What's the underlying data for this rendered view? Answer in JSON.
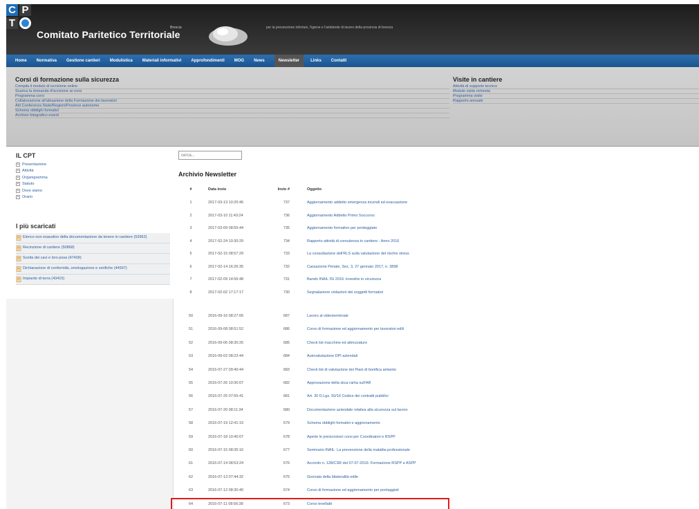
{
  "header": {
    "logo_letters": [
      "C",
      "P",
      "T"
    ],
    "brand": "Comitato Paritetico Territoriale",
    "brand_sub": "Brescia",
    "tagline": "per la prevenzione infortuni, l'igiene e l'ambiente di lavoro della provincia di brescia"
  },
  "nav": [
    "Home",
    "Normativa",
    "Gestione cantieri",
    "Modulistica",
    "Materiali informativi",
    "Approfondimenti",
    "MOG",
    "News",
    "Newsletter",
    "Links",
    "Contatti"
  ],
  "nav_active": "Newsletter",
  "training": {
    "title": "Corsi di formazione sulla sicurezza",
    "links": [
      "Compila il modulo di iscrizione online",
      "Scarica la domanda d'iscrizione ai corsi",
      "Programma corsi",
      "Collaborazione all'attuazione della Formazione dei lavoratori",
      "Atti Conferenza Stato/Regioni/Province autonome",
      "Schema obblighi formativi",
      "Archivio fotografico eventi"
    ]
  },
  "visits": {
    "title": "Visite in cantiere",
    "links": [
      "Attività di supporto tecnico",
      "Modulo visita richiesta",
      "Programma visite",
      "Rapporto annuale"
    ]
  },
  "cpt": {
    "title": "IL CPT",
    "items": [
      "Presentazione",
      "Attività",
      "Organigramma",
      "Statuto",
      "Dove siamo",
      "Orario"
    ]
  },
  "downloads": {
    "title": "I più scaricati",
    "items": [
      "Elenco non esaustivo della documentazione da tenere in cantiere (53962)",
      "Recinzione di cantiere (50868)",
      "Scelta dei cavi e loro posa (47409)",
      "Dichiarazione di conformità, omologazione e verifiche (44597)",
      "Impianto di terra (43415)"
    ]
  },
  "search": {
    "placeholder": "cerca..."
  },
  "archive": {
    "title": "Archivio Newsletter",
    "headers": [
      "#",
      "Data invio",
      "Invio #",
      "Oggetto"
    ],
    "rows_top": [
      [
        "1",
        "2017-03-13 10:20:46",
        "737",
        "Aggiornamento addetto emergenza incendi ed evacuazione"
      ],
      [
        "2",
        "2017-03-10 11:43:24",
        "736",
        "Aggiornamento Addetto Primo Soccorso"
      ],
      [
        "3",
        "2017-03-09 08:55:44",
        "735",
        "Aggiornamento formativo per ponteggiato"
      ],
      [
        "4",
        "2017-02-24 10:30:29",
        "734",
        "Rapporto attività di consulenza in cantiere - Anno 2016"
      ],
      [
        "5",
        "2017-02-15 08:57:29",
        "733",
        "La consultazione dell'RLS sulla valutazione del rischio stress"
      ],
      [
        "6",
        "2017-02-14 16:26:35",
        "732",
        "Cassazione Penale, Sez. 3, 27 gennaio 2017, n. 3898"
      ],
      [
        "7",
        "2017-02-09 14:56:48",
        "731",
        "Bando INAIL ISI 2016: investire in sicurezza"
      ],
      [
        "8",
        "2017-02-02 17:17:17",
        "730",
        "Segnalazione violazioni dei soggetti formatori"
      ]
    ],
    "rows_bottom": [
      [
        "50",
        "2016-09-16 08:27:06",
        "687",
        "Lavoro al videoterminale"
      ],
      [
        "51",
        "2016-09-08 08:51:52",
        "686",
        "Corso di formazione ed aggiornamento per lavoratori edili"
      ],
      [
        "52",
        "2016-09-06 08:30:26",
        "685",
        "Check list macchine ed attrezzature"
      ],
      [
        "53",
        "2016-09-02 08:22:44",
        "684",
        "Autovalutazione DPI aziendali"
      ],
      [
        "54",
        "2016-07-27 09:40:44",
        "683",
        "Check list di valutazione dei Piani di bonifica amianto"
      ],
      [
        "55",
        "2016-07-26 10:30:07",
        "682",
        "Approvazione della skca rarha sull'AR"
      ],
      [
        "56",
        "2016-07-25 07:55:41",
        "681",
        "Art. 30 D.Lgs. 50/16 Codice dei contratti pubblici"
      ],
      [
        "57",
        "2016-07-20 08:11:34",
        "680",
        "Documentazione aziendale relativa alla sicurezza sul lavoro"
      ],
      [
        "58",
        "2016-07-19 12:41:19",
        "679",
        "Schema obblighi formativi e aggiornamento"
      ],
      [
        "59",
        "2016-07-18 10:40:07",
        "678",
        "Aperte le preiscrizioni corsi per Coordinatori e RSPP"
      ],
      [
        "60",
        "2016-07-15 08:35:16",
        "677",
        "Seminario INAIL: La prevenzione della malattia professionale"
      ],
      [
        "61",
        "2016-07-14 08:53:24",
        "676",
        "Accordo n. 128/CSR del 07-07-2016: Formazione RSPP e ASPP"
      ],
      [
        "62",
        "2016-07-13 07:44:32",
        "675",
        "Giornata della bilateralità edile"
      ],
      [
        "63",
        "2016-07-12 08:30:40",
        "674",
        "Corso di formazione ed aggiornamento per pontaggisti"
      ],
      [
        "64",
        "2016-07-11 08:56:38",
        "673",
        "Corso levellatti"
      ]
    ]
  },
  "colors": {
    "nav_blue": "#2b6fb0",
    "link_blue": "#2d5d9e",
    "highlight_red": "#e01b1b",
    "header_dark": "#1d1d1d"
  }
}
